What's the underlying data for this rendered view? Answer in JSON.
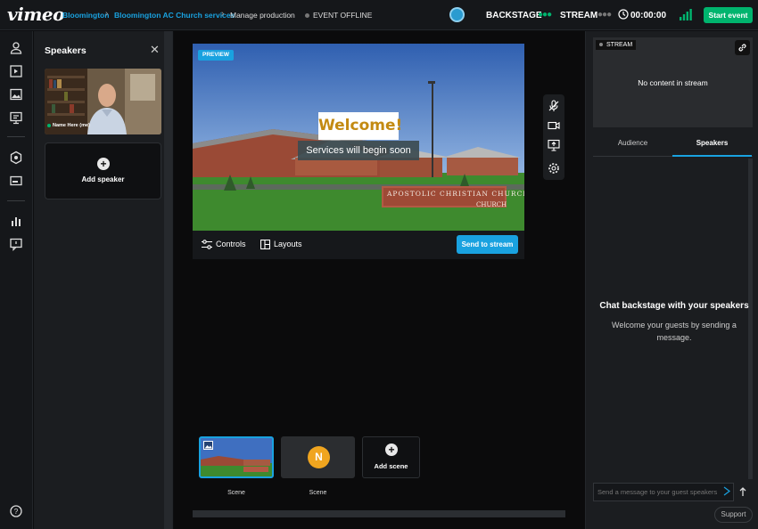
{
  "app": {
    "logo": "vimeo"
  },
  "breadcrumbs": [
    {
      "label": "Bloomington"
    },
    {
      "label": "Bloomington AC Church services"
    },
    {
      "label": "Manage production"
    }
  ],
  "event_status": "EVENT OFFLINE",
  "header": {
    "backstage_label": "BACKSTAGE",
    "stream_label": "STREAM",
    "timer": "00:00:00",
    "start_label": "Start event",
    "colors": {
      "accent": "#19a2e0",
      "start": "#00b46e",
      "backstage_dots": "#00b46e"
    }
  },
  "rail_icons": [
    "person-icon",
    "playlist-icon",
    "image-icon",
    "presentation-icon",
    "overlay-icon",
    "banner-icon",
    "analytics-icon",
    "chat-icon",
    "help-icon"
  ],
  "speakers_panel": {
    "title": "Speakers",
    "speaker_name": "Name Here (me)",
    "add_speaker_label": "Add speaker"
  },
  "preview": {
    "badge": "PREVIEW",
    "welcome_text": "Welcome!",
    "services_text": "Services will begin soon",
    "sign_text": "APOSTOLIC CHRISTIAN CHURCH",
    "sign_text_2": "CHURCH",
    "controls_label": "Controls",
    "layouts_label": "Layouts",
    "send_label": "Send to stream"
  },
  "scenes": [
    {
      "label": "Scene"
    },
    {
      "label": "Scene",
      "initial": "N"
    }
  ],
  "add_scene_label": "Add scene",
  "right_panel": {
    "stream_badge": "STREAM",
    "no_content": "No content in stream",
    "tabs": [
      {
        "label": "Audience"
      },
      {
        "label": "Speakers"
      }
    ],
    "active_tab": "Speakers",
    "chat_title": "Chat backstage with your speakers",
    "chat_subtitle": "Welcome your guests by sending a message.",
    "message_placeholder": "Send a message to your guest speakers",
    "support_label": "Support"
  }
}
